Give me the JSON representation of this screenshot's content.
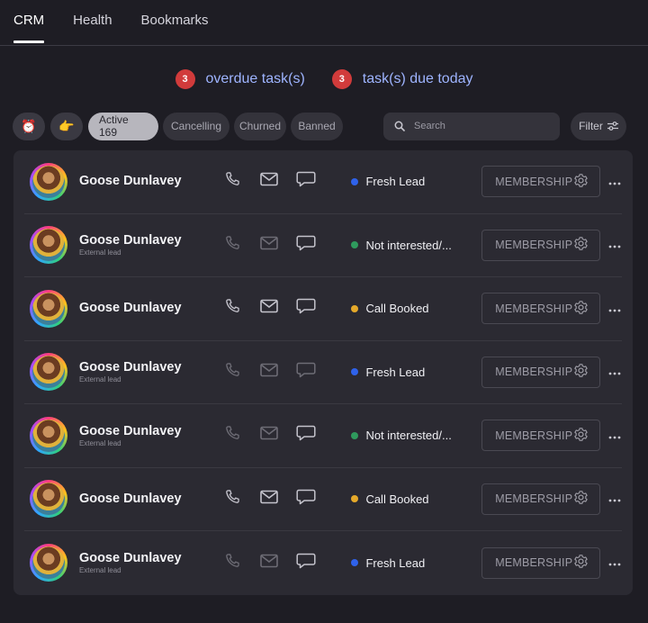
{
  "tabs": [
    {
      "label": "CRM"
    },
    {
      "label": "Health"
    },
    {
      "label": "Bookmarks"
    }
  ],
  "tasks": {
    "overdue": {
      "count": "3",
      "label": "overdue task(s)"
    },
    "today": {
      "count": "3",
      "label": "task(s) due today"
    }
  },
  "filters": {
    "icon_alarm": "alarm-clock-icon",
    "icon_point": "pointing-hand-icon",
    "active": "Active 169",
    "cancelling": "Cancelling",
    "churned": "Churned",
    "banned": "Banned",
    "search_placeholder": "Search",
    "filter_label": "Filter"
  },
  "membership_label": "MEMBERSHIP",
  "status_colors": {
    "fresh": "#2f62ea",
    "not_interested": "#2f9a5d",
    "call_booked": "#e5a92a"
  },
  "rows": [
    {
      "name": "Goose Dunlavey",
      "sub": "",
      "status": "Fresh Lead",
      "status_color": "#2f62ea",
      "contact_enabled": true
    },
    {
      "name": "Goose Dunlavey",
      "sub": "External lead",
      "status": "Not interested/...",
      "status_color": "#2f9a5d",
      "contact_enabled": false
    },
    {
      "name": "Goose Dunlavey",
      "sub": "",
      "status": "Call Booked",
      "status_color": "#e5a92a",
      "contact_enabled": true
    },
    {
      "name": "Goose Dunlavey",
      "sub": "External lead",
      "status": "Fresh Lead",
      "status_color": "#2f62ea",
      "contact_enabled": false
    },
    {
      "name": "Goose Dunlavey",
      "sub": "External lead",
      "status": "Not interested/...",
      "status_color": "#2f9a5d",
      "contact_enabled": false
    },
    {
      "name": "Goose Dunlavey",
      "sub": "",
      "status": "Call Booked",
      "status_color": "#e5a92a",
      "contact_enabled": true
    },
    {
      "name": "Goose Dunlavey",
      "sub": "External lead",
      "status": "Fresh Lead",
      "status_color": "#2f62ea",
      "contact_enabled": false
    }
  ]
}
